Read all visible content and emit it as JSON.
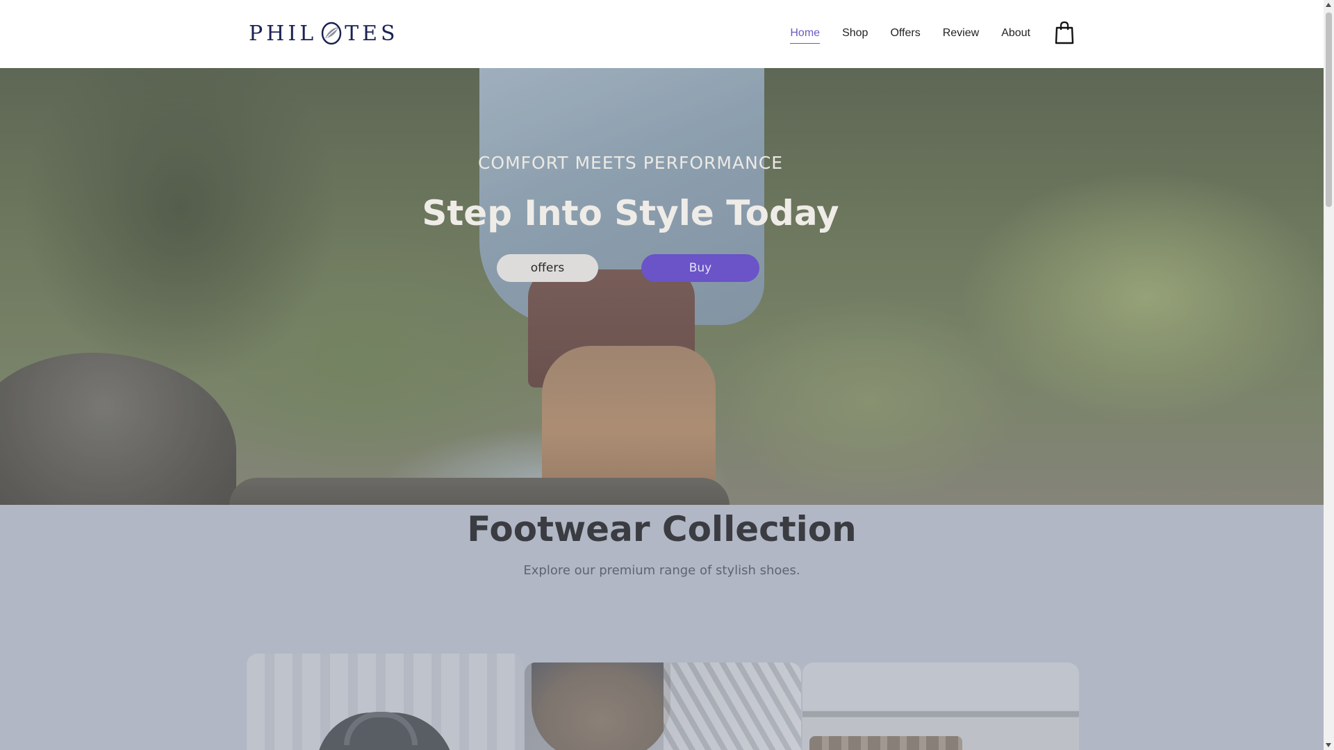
{
  "header": {
    "logo_text_left": "PHIL",
    "logo_text_right": "TES",
    "nav": [
      {
        "label": "Home",
        "active": true
      },
      {
        "label": "Shop",
        "active": false
      },
      {
        "label": "Offers",
        "active": false
      },
      {
        "label": "Review",
        "active": false
      },
      {
        "label": "About",
        "active": false
      }
    ],
    "cart_icon": "shopping-bag-icon"
  },
  "hero": {
    "eyebrow": "COMFORT MEETS PERFORMANCE",
    "title": "Step Into Style Today",
    "offers_button": "offers",
    "buy_button": "Buy"
  },
  "collection": {
    "title": "Footwear Collection",
    "subtitle": "Explore our premium range of stylish shoes."
  },
  "colors": {
    "accent": "#6a54c8",
    "nav_active": "#6a5ac4",
    "logo": "#1b2152",
    "page_bg": "#b1b7c4"
  }
}
